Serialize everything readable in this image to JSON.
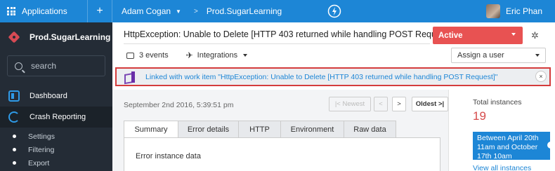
{
  "topbar": {
    "applications_label": "Applications",
    "add_label": "+",
    "org_label": "Adam Cogan",
    "breadcrumb_sep": ">",
    "app_label": "Prod.SugarLearning",
    "user_name": "Eric Phan"
  },
  "sidebar": {
    "app_name": "Prod.SugarLearning",
    "search_placeholder": "search",
    "nav": [
      {
        "label": "Dashboard"
      },
      {
        "label": "Crash Reporting"
      }
    ],
    "sub_items": [
      {
        "label": "Settings"
      },
      {
        "label": "Filtering"
      },
      {
        "label": "Export"
      }
    ]
  },
  "issue": {
    "title": "HttpException: Unable to Delete [HTTP 403 returned while handling POST Requ...",
    "status": "Active",
    "events_label": "3 events",
    "integrations_label": "Integrations",
    "assign_placeholder": "Assign a user"
  },
  "banner": {
    "text": "Linked with work item \"HttpException: Unable to Delete [HTTP 403 returned while handling POST Request]\"",
    "close_label": "×"
  },
  "pager": {
    "date": "September 2nd 2016, 5:39:51 pm",
    "newest_label": "|< Newest",
    "prev_label": "<",
    "next_label": ">",
    "oldest_label": "Oldest >|"
  },
  "tabs": [
    {
      "label": "Summary",
      "active": true
    },
    {
      "label": "Error details"
    },
    {
      "label": "HTTP"
    },
    {
      "label": "Environment"
    },
    {
      "label": "Raw data"
    }
  ],
  "panel": {
    "title": "Error instance data"
  },
  "stats": {
    "total_label": "Total instances",
    "total_count": "19",
    "range_text": "Between April 20th 11am and October 17th 10am",
    "view_all_label": "View all instances"
  },
  "colors": {
    "topbar": "#1d86d6",
    "sidebar": "#242c36",
    "status_active": "#e85252",
    "banner_border": "#d43c3c",
    "link": "#1d86d6",
    "count": "#d64a4a"
  },
  "icons": {
    "applications": "grid-icon",
    "lightning": "bolt-icon",
    "search": "search-icon",
    "dashboard": "dashboard-icon",
    "crash": "crash-reporting-icon",
    "settings": "gear-icon",
    "events": "comment-icon",
    "integrations": "plug-icon",
    "work_item": "visual-studio-icon",
    "close": "close-icon"
  }
}
